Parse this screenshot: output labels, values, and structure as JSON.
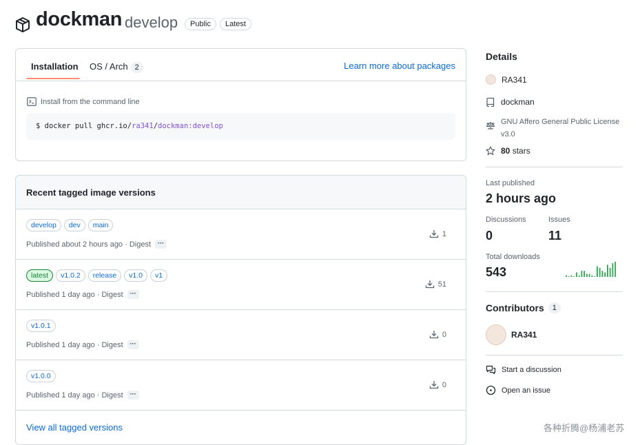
{
  "header": {
    "title": "dockman",
    "subtitle": "develop",
    "badges": [
      "Public",
      "Latest"
    ]
  },
  "install": {
    "tabs": [
      {
        "label": "Installation",
        "selected": true
      },
      {
        "label": "OS / Arch",
        "count": "2",
        "selected": false
      }
    ],
    "learn_link": "Learn more about packages",
    "cmd_label": "Install from the command line",
    "cmd_prefix": "$ docker pull ghcr.io/",
    "cmd_owner": "ra341",
    "cmd_slash": "/",
    "cmd_image": "dockman:develop"
  },
  "versions": {
    "heading": "Recent tagged image versions",
    "rows": [
      {
        "tags": [
          "develop",
          "dev",
          "main"
        ],
        "published": "Published about 2 hours ago · Digest",
        "downloads": "1"
      },
      {
        "tags": [
          "latest",
          "v1.0.2",
          "release",
          "v1.0",
          "v1"
        ],
        "published": "Published 1 day ago · Digest",
        "downloads": "51"
      },
      {
        "tags": [
          "v1.0.1"
        ],
        "published": "Published 1 day ago · Digest",
        "downloads": "0"
      },
      {
        "tags": [
          "v1.0.0"
        ],
        "published": "Published 1 day ago · Digest",
        "downloads": "0"
      }
    ],
    "digest_more": "···",
    "view_all": "View all tagged versions"
  },
  "details": {
    "heading": "Details",
    "owner": "RA341",
    "repo": "dockman",
    "license_line1": "GNU Affero General Public License",
    "license_line2": "v3.0",
    "stars_count": "80",
    "stars_word": "stars"
  },
  "stats": {
    "last_published_label": "Last published",
    "last_published_value": "2 hours ago",
    "discussions_label": "Discussions",
    "discussions_value": "0",
    "issues_label": "Issues",
    "issues_value": "11",
    "downloads_label": "Total downloads",
    "downloads_value": "543",
    "downloads_sparkline": [
      1,
      0,
      1,
      0,
      3,
      1,
      4,
      4,
      2,
      2,
      1,
      0,
      7,
      6,
      4,
      3,
      8,
      6,
      9,
      10
    ]
  },
  "contributors": {
    "heading": "Contributors",
    "count": "1",
    "name": "RA341"
  },
  "actions": {
    "discussion": "Start a discussion",
    "issue": "Open an issue"
  },
  "watermark": "各种折腾@杨浦老苏",
  "colors": {
    "link": "#0969da",
    "tab_underline": "#fd8c73",
    "sparkline": "#2da44e",
    "latest_tag": "#1a7f37"
  }
}
